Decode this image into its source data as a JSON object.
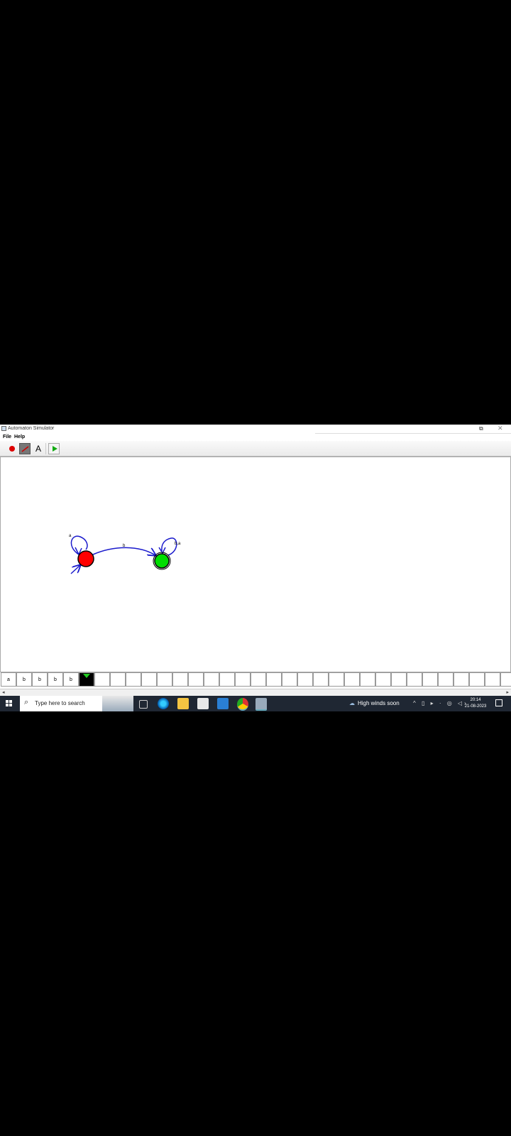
{
  "window": {
    "title": "Automaton Simulator",
    "restore_glyph": "⧉",
    "close_glyph": "✕"
  },
  "menu": {
    "file": "File",
    "help": "Help"
  },
  "toolbar": {
    "state_tool": "add-state-icon",
    "transition_tool": "add-transition-icon",
    "text_tool_label": "A",
    "run_tool": "play-icon"
  },
  "automaton": {
    "states": [
      {
        "id": "q0",
        "initial": true,
        "accepting": false,
        "color": "#ff0000"
      },
      {
        "id": "q1",
        "initial": false,
        "accepting": true,
        "color": "#00dd00"
      }
    ],
    "transitions": [
      {
        "from": "q0",
        "to": "q0",
        "label": "a"
      },
      {
        "from": "q0",
        "to": "q1",
        "label": "b"
      },
      {
        "from": "q1",
        "to": "q1",
        "label": "b,a"
      }
    ],
    "edge_color": "#1a1acc"
  },
  "tape": {
    "cells": [
      "a",
      "b",
      "b",
      "b",
      "b",
      "",
      "",
      "",
      "",
      "",
      "",
      "",
      "",
      "",
      "",
      "",
      "",
      "",
      "",
      "",
      "",
      "",
      "",
      "",
      "",
      "",
      "",
      "",
      "",
      "",
      "",
      "",
      ""
    ],
    "head_index": 5
  },
  "scrollbar": {
    "left": "◂",
    "right": "▸"
  },
  "taskbar": {
    "search_placeholder": "Type here to search",
    "weather": "High winds soon",
    "tray": "^ ▯ ▸ · ◎ ◁›",
    "time": "20:14",
    "date": "21-08-2023"
  }
}
